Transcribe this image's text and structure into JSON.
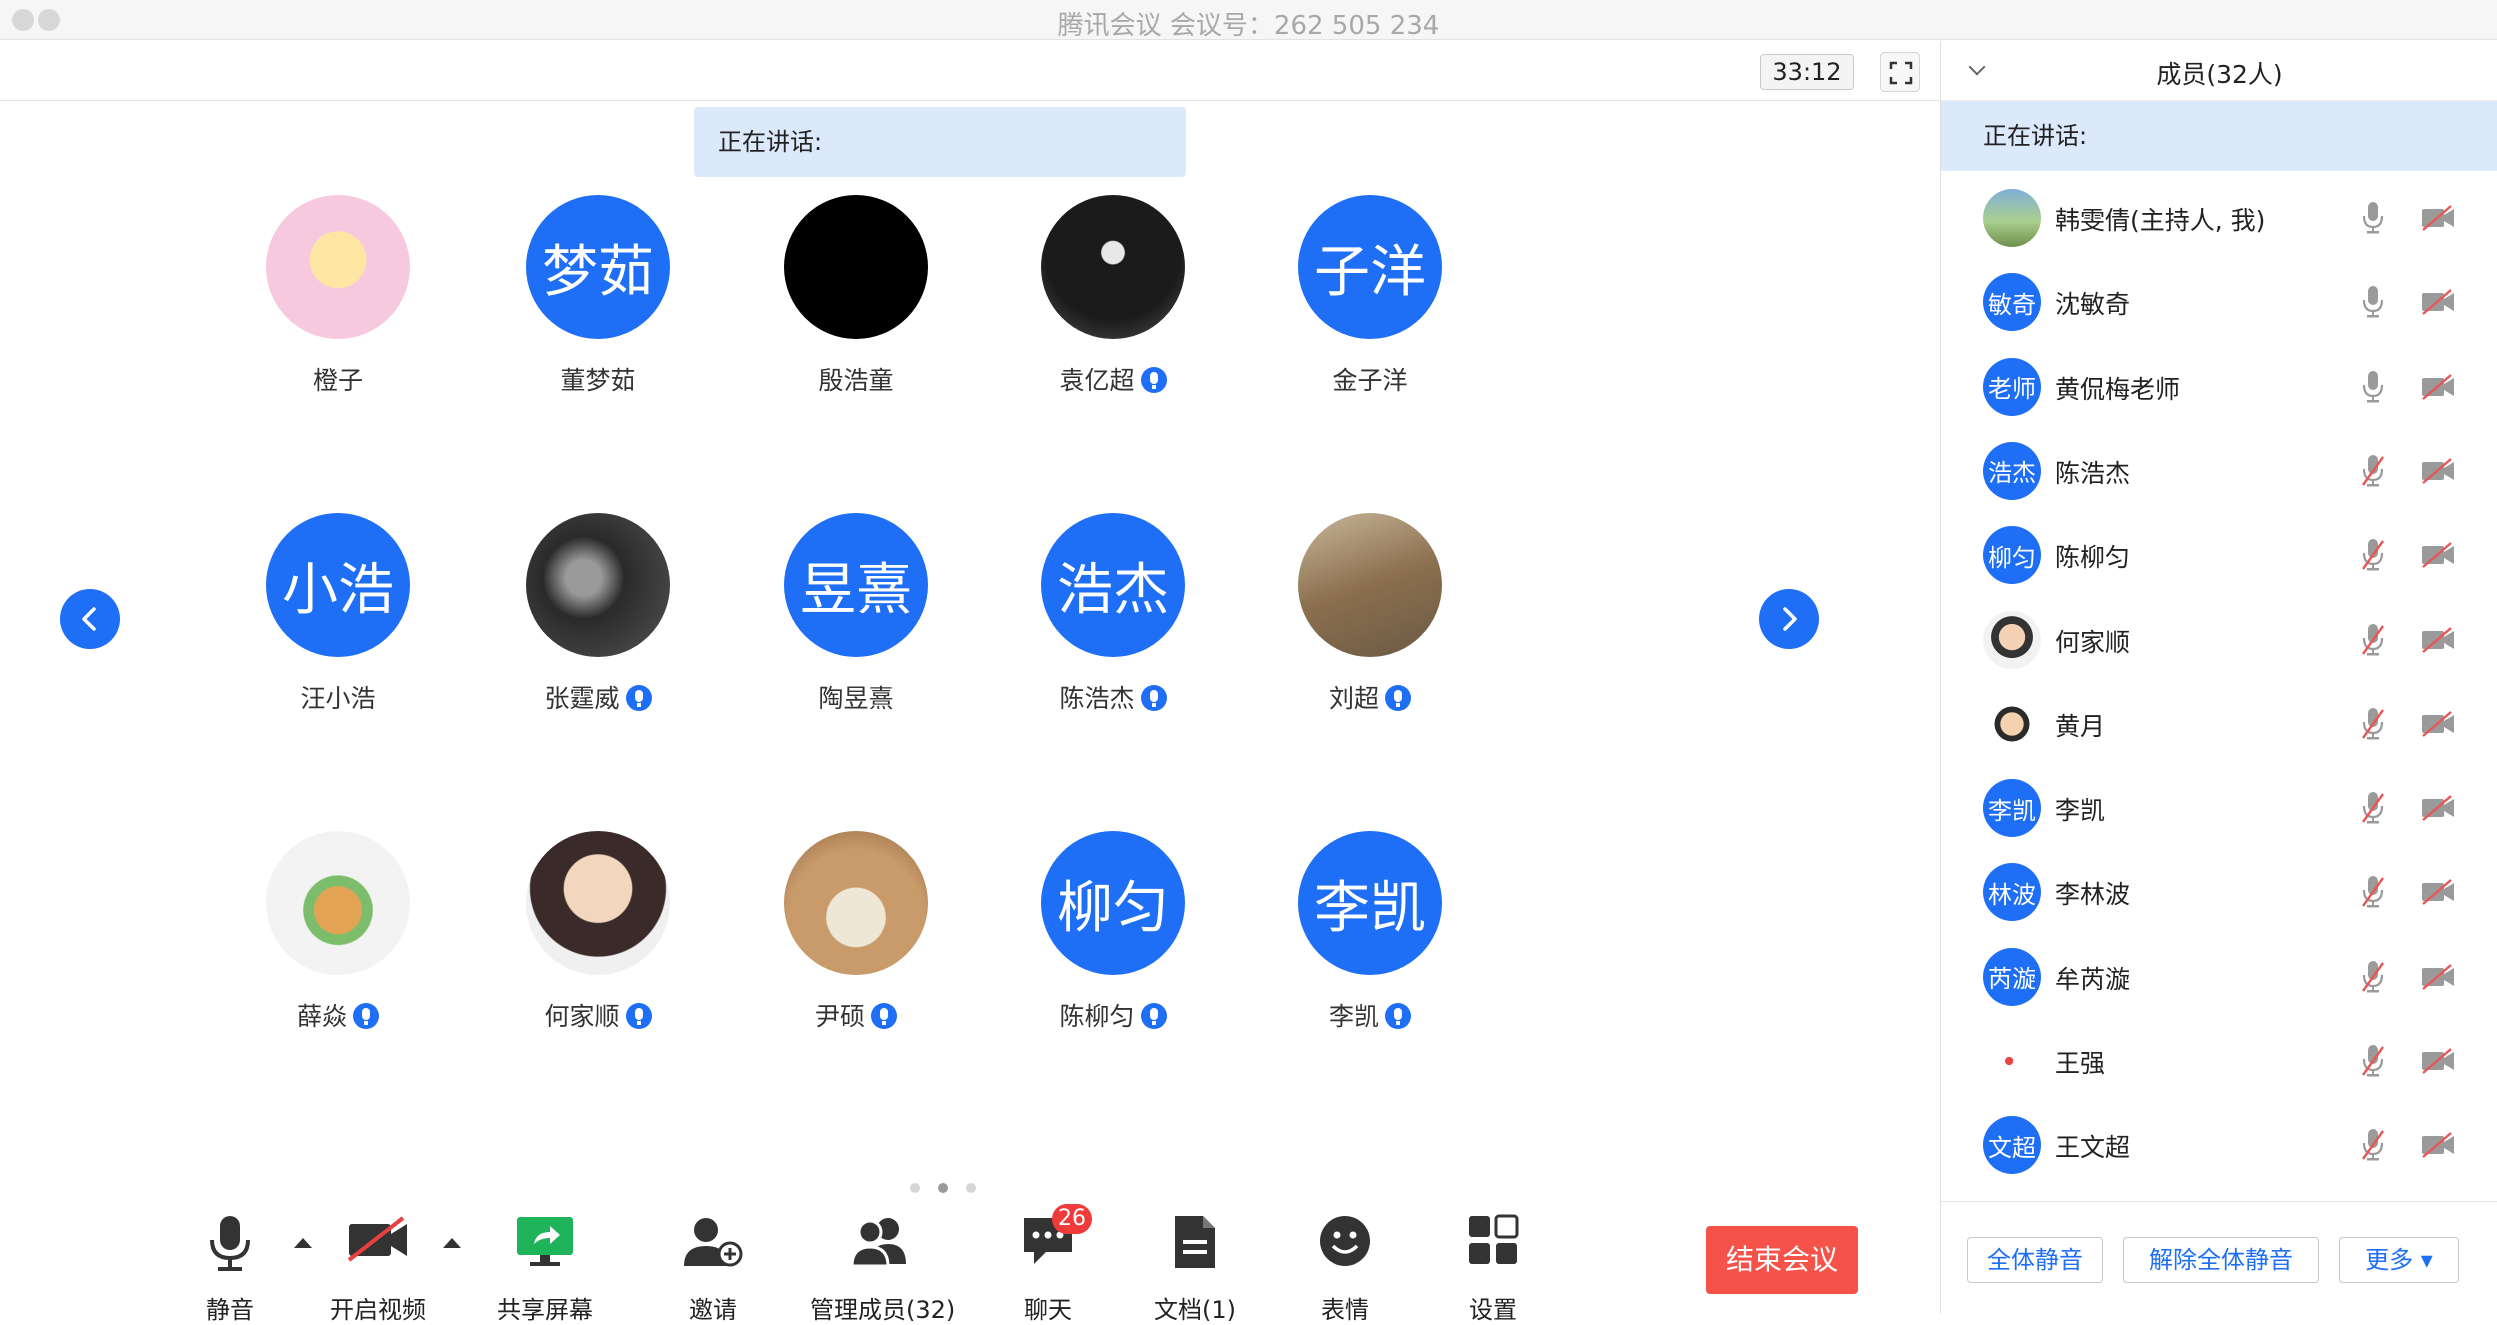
{
  "window": {
    "title": "腾讯会议 会议号：262 505 234"
  },
  "meeting": {
    "timer": "33:12",
    "speaking_label": "正在讲话:",
    "participants": [
      {
        "name": "橙子",
        "avatar_text": "",
        "avatar_kind": "photo",
        "mic_badge": false
      },
      {
        "name": "董梦茹",
        "avatar_text": "梦茹",
        "avatar_kind": "text",
        "mic_badge": false
      },
      {
        "name": "殷浩童",
        "avatar_text": "",
        "avatar_kind": "black",
        "mic_badge": false
      },
      {
        "name": "袁亿超",
        "avatar_text": "",
        "avatar_kind": "photo",
        "mic_badge": true
      },
      {
        "name": "金子洋",
        "avatar_text": "子洋",
        "avatar_kind": "text",
        "mic_badge": false
      },
      {
        "name": "汪小浩",
        "avatar_text": "小浩",
        "avatar_kind": "text",
        "mic_badge": false
      },
      {
        "name": "张霆威",
        "avatar_text": "",
        "avatar_kind": "photo",
        "mic_badge": true
      },
      {
        "name": "陶昱熹",
        "avatar_text": "昱熹",
        "avatar_kind": "text",
        "mic_badge": false
      },
      {
        "name": "陈浩杰",
        "avatar_text": "浩杰",
        "avatar_kind": "text",
        "mic_badge": true
      },
      {
        "name": "刘超",
        "avatar_text": "",
        "avatar_kind": "photo",
        "mic_badge": true
      },
      {
        "name": "薛焱",
        "avatar_text": "",
        "avatar_kind": "photo",
        "mic_badge": true
      },
      {
        "name": "何家顺",
        "avatar_text": "",
        "avatar_kind": "photo",
        "mic_badge": true
      },
      {
        "name": "尹硕",
        "avatar_text": "",
        "avatar_kind": "photo",
        "mic_badge": true
      },
      {
        "name": "陈柳匀",
        "avatar_text": "柳匀",
        "avatar_kind": "text",
        "mic_badge": true
      },
      {
        "name": "李凯",
        "avatar_text": "李凯",
        "avatar_kind": "text",
        "mic_badge": true
      }
    ],
    "pagination": {
      "pages": 3,
      "current": 2
    }
  },
  "toolbar": {
    "mute": "静音",
    "video": "开启视频",
    "share": "共享屏幕",
    "invite": "邀请",
    "manage": "管理成员(32)",
    "chat": "聊天",
    "chat_badge": "26",
    "docs": "文档(1)",
    "emoji": "表情",
    "settings": "设置",
    "end": "结束会议"
  },
  "sidebar": {
    "title": "成员(32人)",
    "speaking_label": "正在讲话:",
    "members": [
      {
        "name": "韩雯倩(主持人, 我)",
        "avatar_text": "",
        "avatar_kind": "photo",
        "mic": "on"
      },
      {
        "name": "沈敏奇",
        "avatar_text": "敏奇",
        "avatar_kind": "text",
        "mic": "on"
      },
      {
        "name": "黄侃梅老师",
        "avatar_text": "老师",
        "avatar_kind": "text",
        "mic": "on"
      },
      {
        "name": "陈浩杰",
        "avatar_text": "浩杰",
        "avatar_kind": "text",
        "mic": "off"
      },
      {
        "name": "陈柳匀",
        "avatar_text": "柳匀",
        "avatar_kind": "text",
        "mic": "off"
      },
      {
        "name": "何家顺",
        "avatar_text": "",
        "avatar_kind": "photo",
        "mic": "off"
      },
      {
        "name": "黄月",
        "avatar_text": "",
        "avatar_kind": "photo",
        "mic": "off"
      },
      {
        "name": "李凯",
        "avatar_text": "李凯",
        "avatar_kind": "text",
        "mic": "off"
      },
      {
        "name": "李林波",
        "avatar_text": "林波",
        "avatar_kind": "text",
        "mic": "off"
      },
      {
        "name": "牟芮漩",
        "avatar_text": "芮漩",
        "avatar_kind": "text",
        "mic": "off"
      },
      {
        "name": "王强",
        "avatar_text": "",
        "avatar_kind": "photo",
        "mic": "off"
      },
      {
        "name": "王文超",
        "avatar_text": "文超",
        "avatar_kind": "text",
        "mic": "off"
      }
    ],
    "footer": {
      "mute_all": "全体静音",
      "unmute_all": "解除全体静音",
      "more": "更多 ▾"
    }
  },
  "colors": {
    "accent": "#1e6ff5",
    "danger": "#f5534a",
    "speaking_bg": "#dce9fb"
  }
}
